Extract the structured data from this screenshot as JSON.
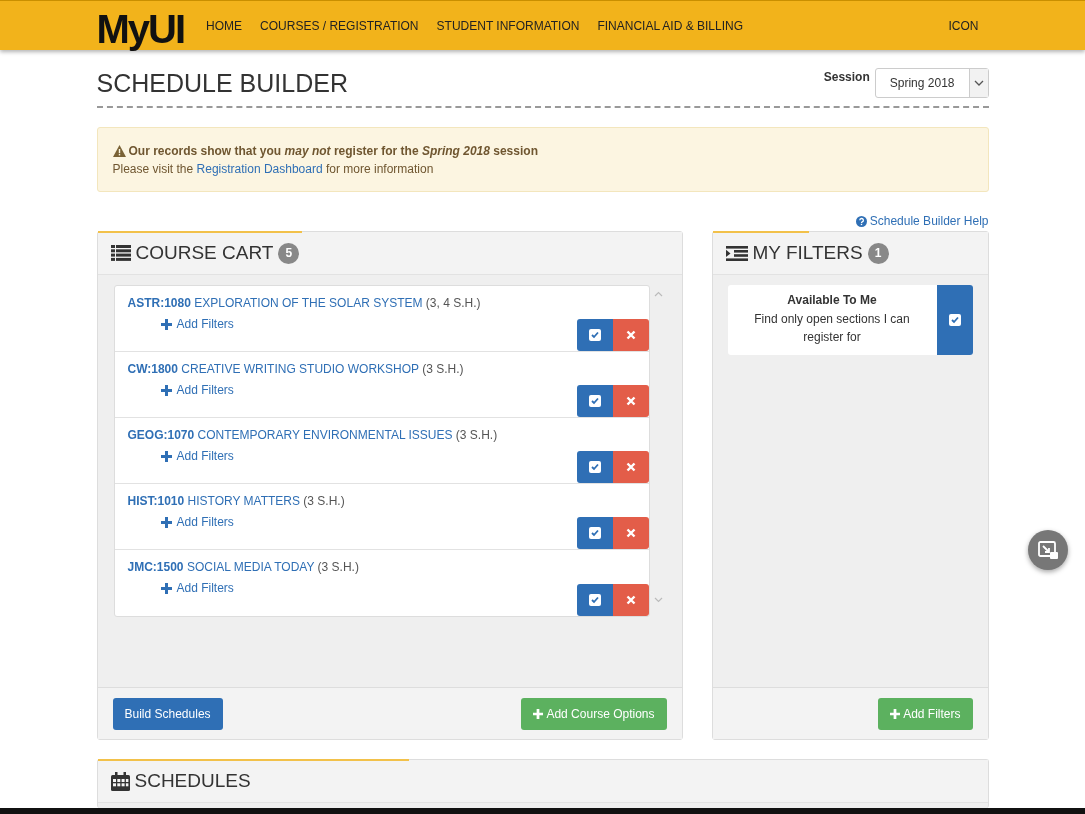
{
  "header": {
    "logo": "MyUI",
    "nav": [
      "HOME",
      "COURSES / REGISTRATION",
      "STUDENT INFORMATION",
      "FINANCIAL AID & BILLING"
    ],
    "right": "ICON"
  },
  "page": {
    "title": "SCHEDULE BUILDER",
    "session_label": "Session",
    "session_value": "Spring 2018"
  },
  "alert": {
    "headline": "Our records show that you *may not* register for the *Spring 2018* session",
    "before": "Please visit the",
    "link": "Registration Dashboard",
    "after": "for more information"
  },
  "help_link": "Schedule Builder Help",
  "course_cart": {
    "title": "COURSE CART",
    "count": "5",
    "courses": [
      {
        "code": "ASTR:1080",
        "name": "EXPLORATION OF THE SOLAR SYSTEM",
        "hours": "(3, 4 S.H.)",
        "add_filters": "Add Filters"
      },
      {
        "code": "CW:1800",
        "name": "CREATIVE WRITING STUDIO WORKSHOP",
        "hours": "(3 S.H.)",
        "add_filters": "Add Filters"
      },
      {
        "code": "GEOG:1070",
        "name": "CONTEMPORARY ENVIRONMENTAL ISSUES",
        "hours": "(3 S.H.)",
        "add_filters": "Add Filters"
      },
      {
        "code": "HIST:1010",
        "name": "HISTORY MATTERS",
        "hours": "(3 S.H.)",
        "add_filters": "Add Filters"
      },
      {
        "code": "JMC:1500",
        "name": "SOCIAL MEDIA TODAY",
        "hours": "(3 S.H.)",
        "add_filters": "Add Filters"
      }
    ],
    "build_button": "Build Schedules",
    "add_button": "Add Course Options"
  },
  "my_filters": {
    "title": "MY FILTERS",
    "count": "1",
    "filters": [
      {
        "title": "Available To Me",
        "description": "Find only open sections I can register for",
        "checked": true
      }
    ],
    "add_button": "Add Filters"
  },
  "schedules": {
    "title": "SCHEDULES"
  }
}
